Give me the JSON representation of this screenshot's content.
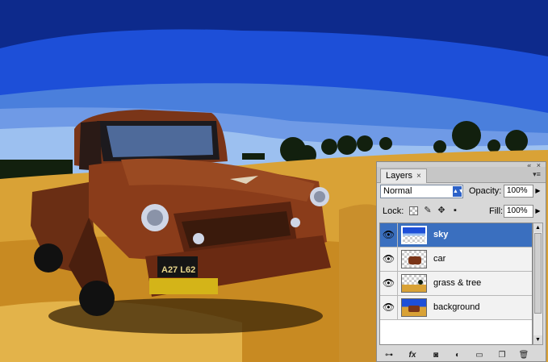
{
  "photo": {
    "plate_text": "A27 L62",
    "colors": {
      "sky_top": "#0d2a8c",
      "sky_mid": "#1d4fd8",
      "sky_light": "#5b8ee0",
      "sky_pale": "#9cc0f0",
      "grass": "#d9a236",
      "truck": "#7a3518"
    }
  },
  "panel": {
    "tab_label": "Layers",
    "tab_close_glyph": "×",
    "window_buttons": "« ×",
    "blend_mode": "Normal",
    "opacity_label": "Opacity:",
    "opacity_value": "100%",
    "lock_label": "Lock:",
    "fill_label": "Fill:",
    "fill_value": "100%",
    "layers": [
      {
        "name": "sky",
        "selected": true,
        "thumb": "sky-thumbnail"
      },
      {
        "name": "car",
        "selected": false,
        "thumb": "car-thumbnail"
      },
      {
        "name": "grass & tree",
        "selected": false,
        "thumb": "grass-thumbnail"
      },
      {
        "name": "background",
        "selected": false,
        "thumb": "background-thumbnail"
      }
    ],
    "footer_icons": [
      "link-layers-icon",
      "fx-icon",
      "layer-mask-icon",
      "adjustment-layer-icon",
      "new-group-icon",
      "new-layer-icon",
      "delete-layer-icon"
    ]
  }
}
